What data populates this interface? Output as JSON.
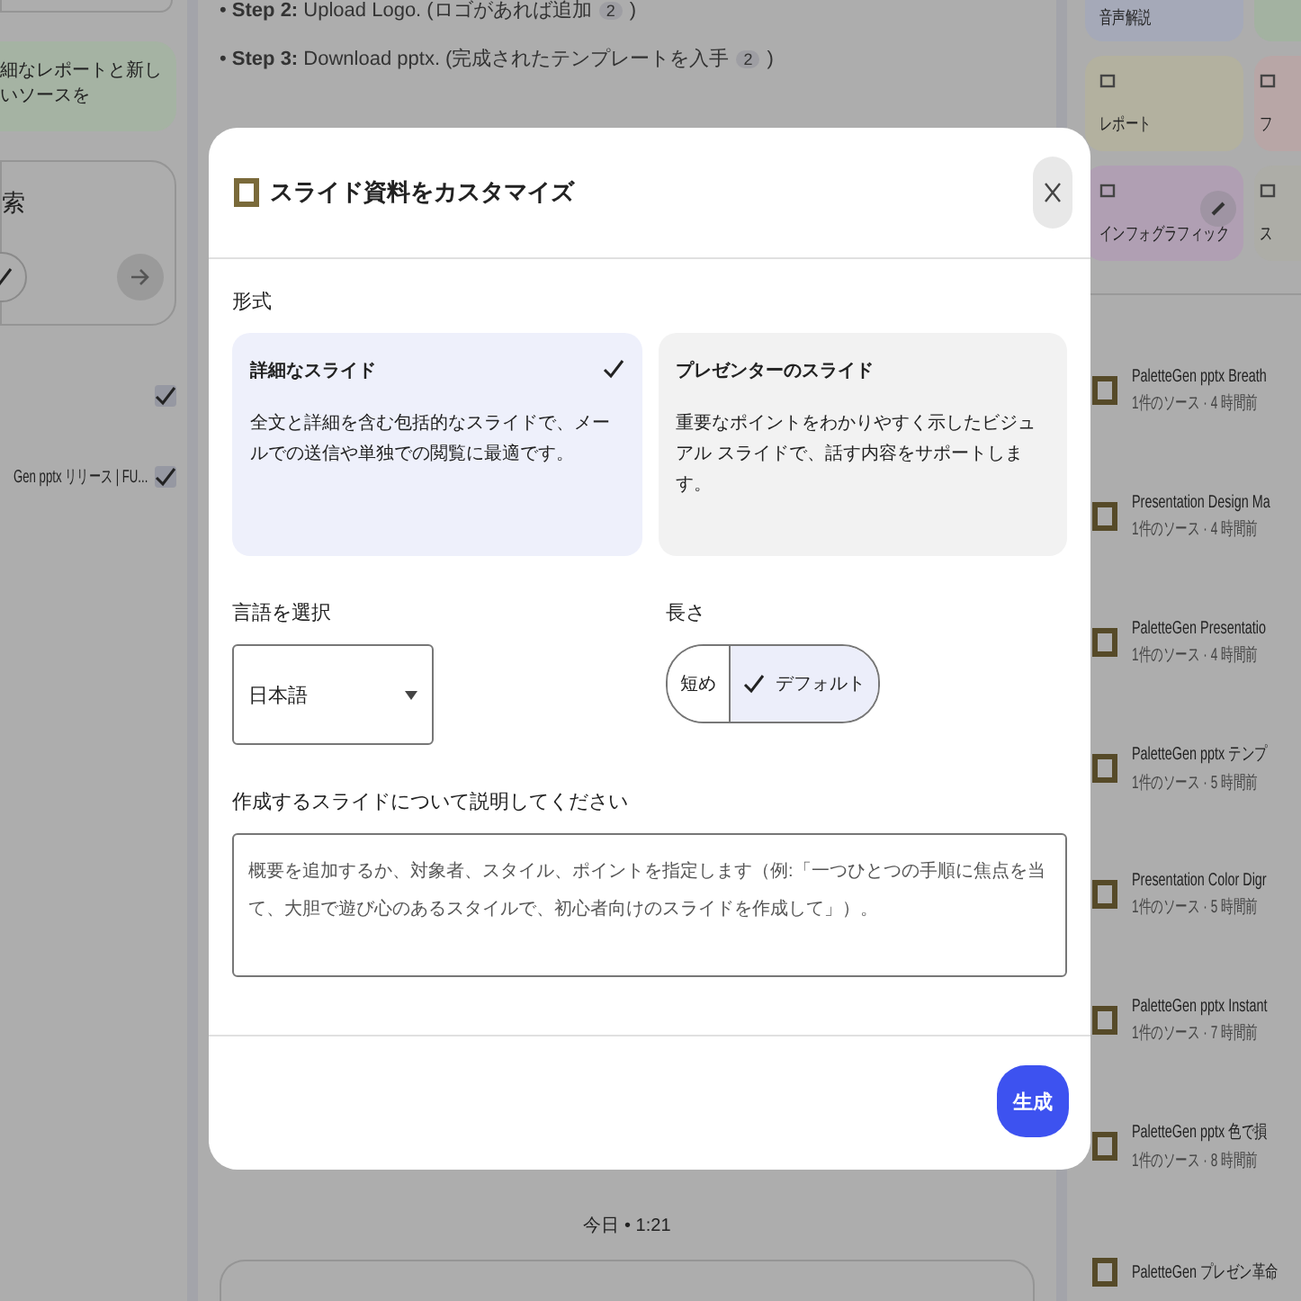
{
  "sidebar": {
    "banner_text": "細なレポートと新しいソースを",
    "card": {
      "title": "索"
    },
    "sources": [
      {
        "checked": true
      },
      {
        "title": "Gen pptx リリース | FU...",
        "checked": true
      }
    ]
  },
  "chat": {
    "steps": [
      {
        "bullet": "•",
        "label": "Step 2:",
        "text": "Upload Logo. (ロゴがあれば追加",
        "citation": "2",
        "tail": ")"
      },
      {
        "bullet": "•",
        "label": "Step 3:",
        "text": "Download pptx. (完成されたテンプレートを入手",
        "citation": "2",
        "tail": ")"
      }
    ],
    "timestamp": "今日 • 1:21"
  },
  "studio": {
    "tiles": [
      {
        "kind": "stub",
        "label": "音声解説",
        "color": "#a5a9b8"
      },
      {
        "kind": "stub",
        "color": "#a3b2a1"
      },
      {
        "kind": "full",
        "label": "レポート",
        "color": "#b3b19f"
      },
      {
        "kind": "full",
        "label": "フ",
        "color": "#b8a6a6"
      },
      {
        "kind": "full",
        "label": "インフォグラフィック",
        "color": "#b09fb3"
      },
      {
        "kind": "full",
        "label": "ス",
        "color": "#adada7"
      }
    ],
    "notes": [
      {
        "title": "PaletteGen pptx Breath",
        "subtitle": "1件のソース · 4 時間前"
      },
      {
        "title": "Presentation Design Ma",
        "subtitle": "1件のソース · 4 時間前"
      },
      {
        "title": "PaletteGen Presentatio",
        "subtitle": "1件のソース · 4 時間前"
      },
      {
        "title": "PaletteGen pptx テンプ",
        "subtitle": "1件のソース · 5 時間前"
      },
      {
        "title": "Presentation Color Digr",
        "subtitle": "1件のソース · 5 時間前"
      },
      {
        "title": "PaletteGen pptx Instant",
        "subtitle": "1件のソース · 7 時間前"
      },
      {
        "title": "PaletteGen pptx 色で損",
        "subtitle": "1件のソース · 8 時間前"
      },
      {
        "title": "PaletteGen プレゼン革命"
      }
    ]
  },
  "dialog": {
    "title": "スライド資料をカスタマイズ",
    "format_label": "形式",
    "formats": [
      {
        "title": "詳細なスライド",
        "description": "全文と詳細を含む包括的なスライドで、メールでの送信や単独での閲覧に最適です。",
        "selected": true
      },
      {
        "title": "プレゼンターのスライド",
        "description": "重要なポイントをわかりやすく示したビジュアル スライドで、話す内容をサポートします。",
        "selected": false
      }
    ],
    "language_label": "言語を選択",
    "language": "日本語",
    "length_label": "長さ",
    "lengths": [
      {
        "label": "短め",
        "selected": false
      },
      {
        "label": "デフォルト",
        "selected": true
      }
    ],
    "description_label": "作成するスライドについて説明してください",
    "description_placeholder": "概要を追加するか、対象者、スタイル、ポイントを指定します（例:「一つひとつの手順に焦点を当て、大胆で遊び心のあるスタイルで、初心者向けのスライドを作成して」）。",
    "generate_button": "生成"
  }
}
